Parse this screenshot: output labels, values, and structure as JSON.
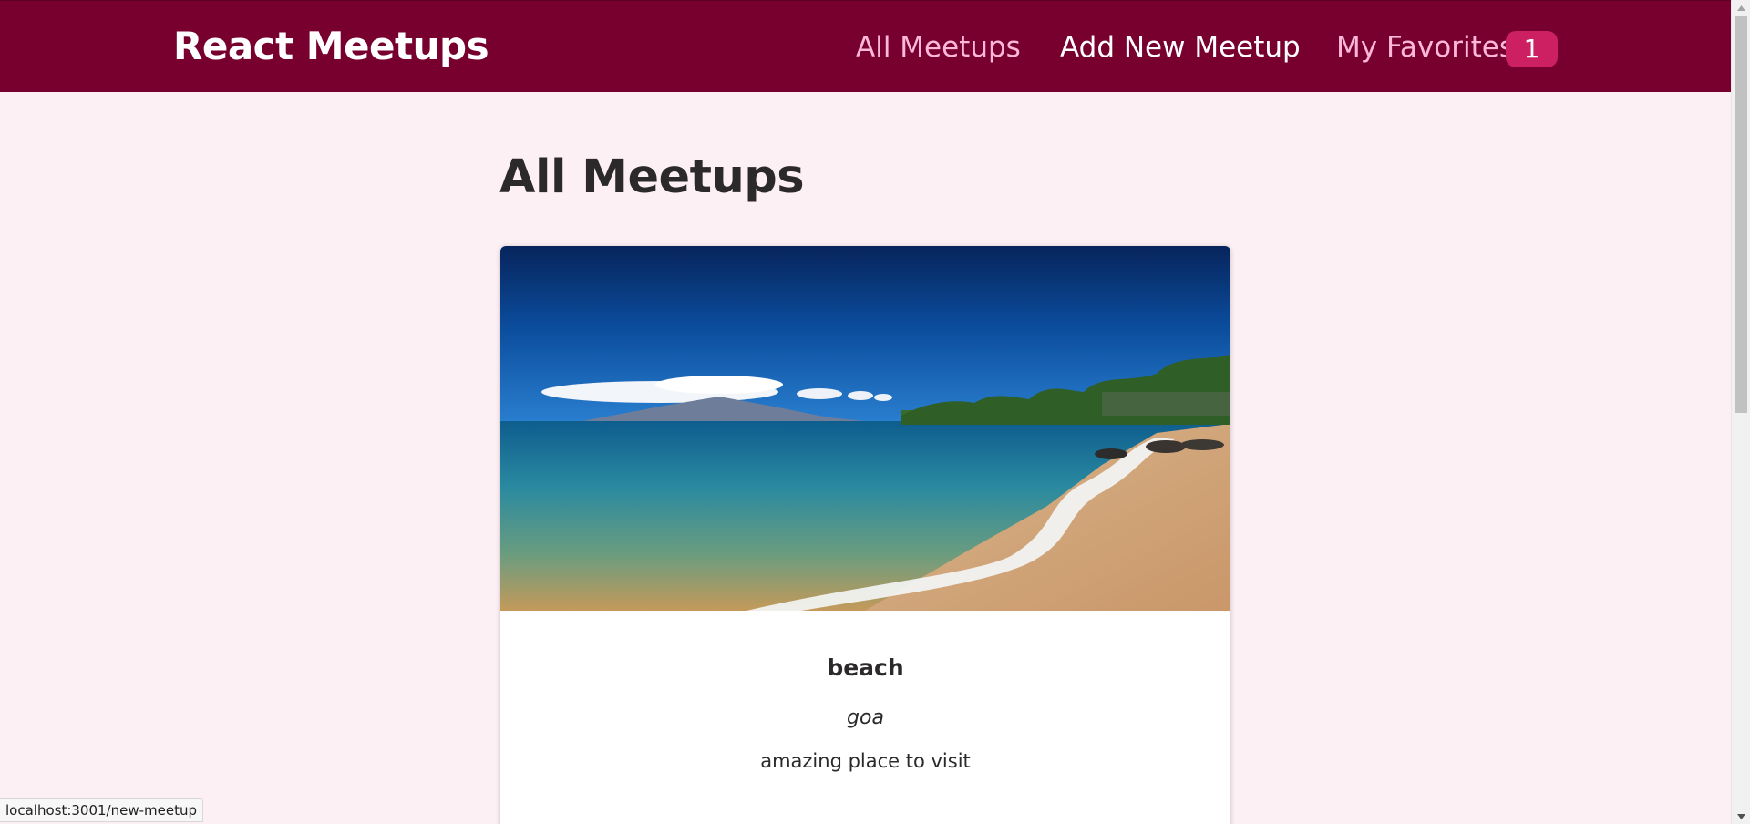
{
  "header": {
    "brand": "React Meetups",
    "nav": [
      {
        "label": "All Meetups"
      },
      {
        "label": "Add New Meetup"
      },
      {
        "label": "My Favorites"
      }
    ],
    "favorites_count": "1"
  },
  "main": {
    "title": "All Meetups",
    "meetups": [
      {
        "title": "beach",
        "address": "goa",
        "description": "amazing place to visit"
      }
    ]
  },
  "status_bar": {
    "url": "localhost:3001/new-meetup"
  },
  "colors": {
    "header_bg": "#77002e",
    "page_bg": "#fcf0f4",
    "badge_bg": "#cc2062",
    "nav_inactive": "#fcb8d6",
    "nav_active": "#ffffff"
  }
}
